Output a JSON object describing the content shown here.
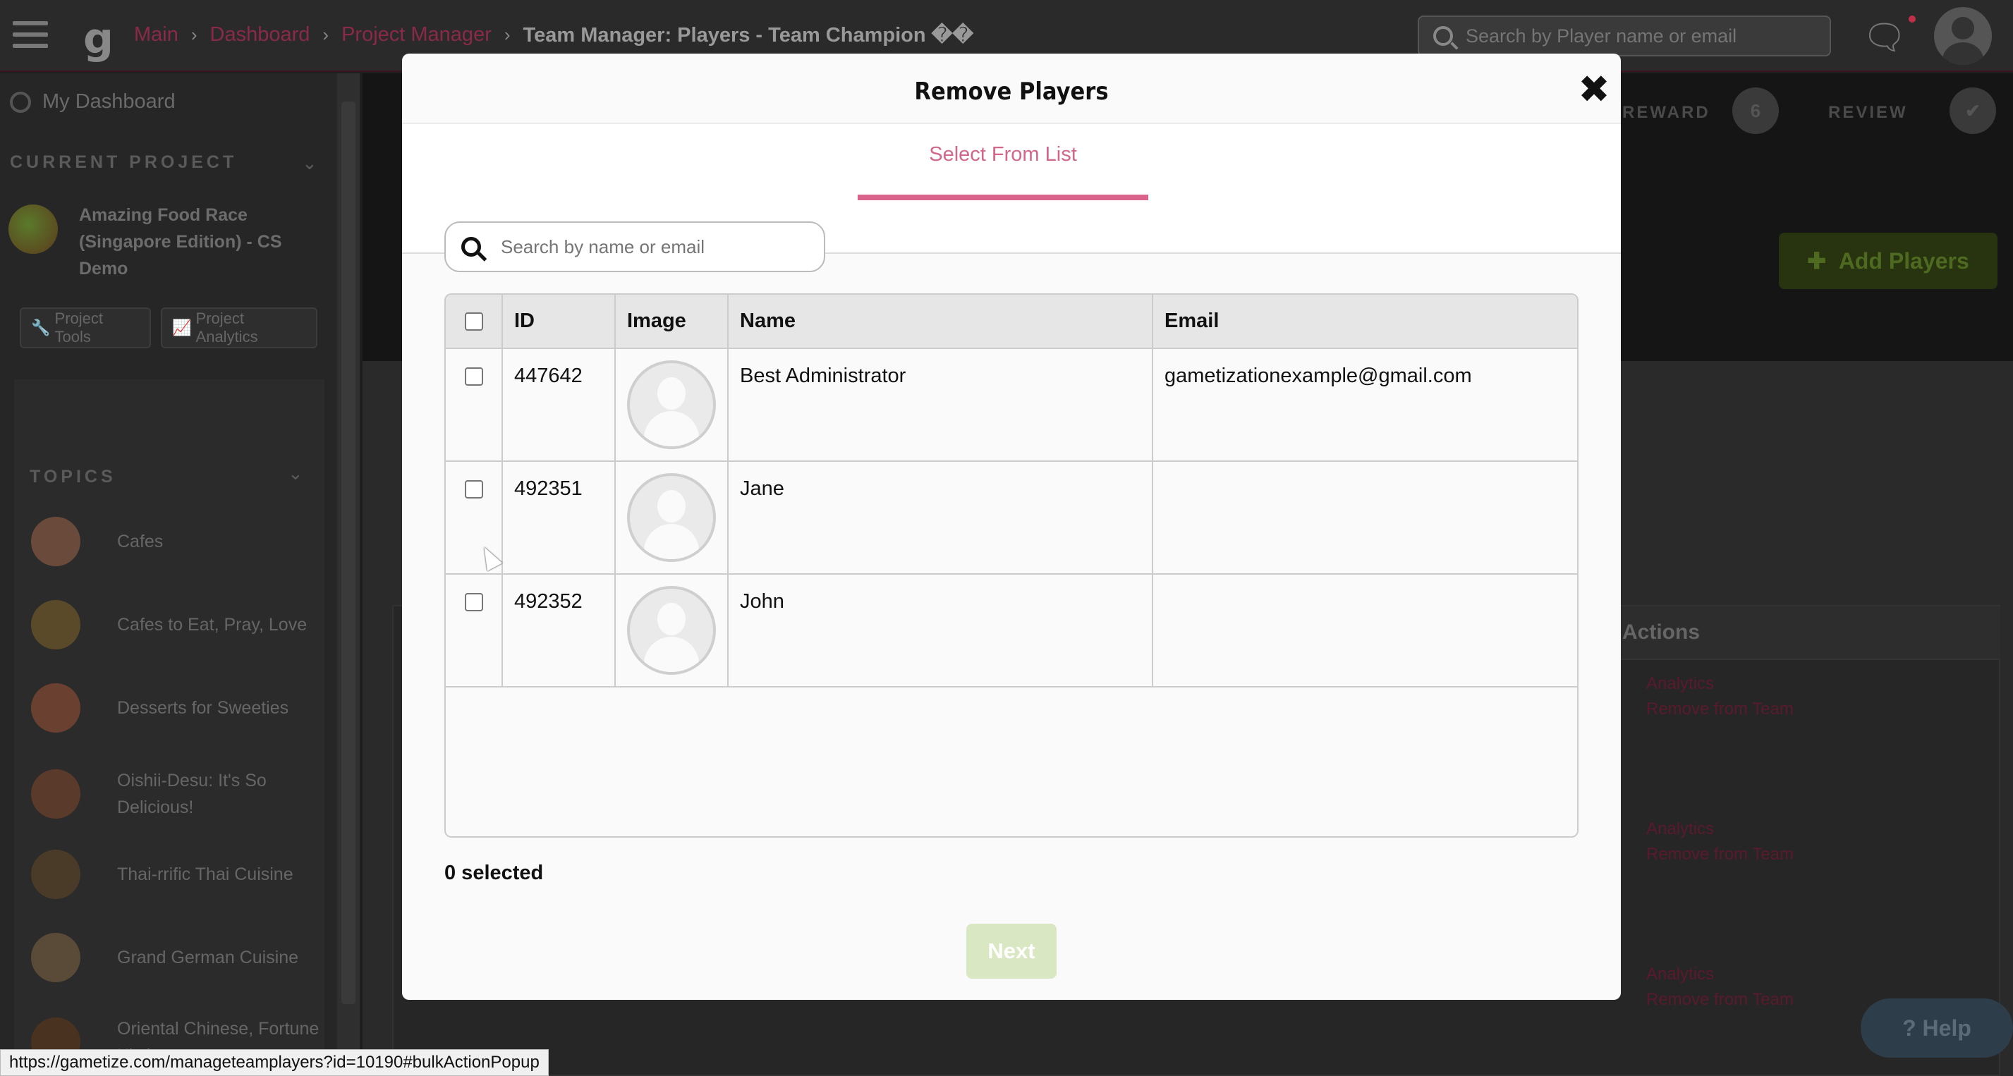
{
  "topbar": {
    "breadcrumbs": [
      "Main",
      "Dashboard",
      "Project Manager"
    ],
    "current_page": "Team Manager: Players - Team Champion ��",
    "search_placeholder": "Search by Player name or email"
  },
  "sidebar": {
    "my_dashboard": "My Dashboard",
    "current_project_label": "CURRENT PROJECT",
    "project_name": "Amazing Food Race (Singapore Edition) - CS Demo",
    "project_tools": "Project Tools",
    "project_analytics": "Project Analytics",
    "topics_label": "TOPICS",
    "topics": [
      {
        "label": "Cafes",
        "color": "#6a4a3a"
      },
      {
        "label": "Cafes to Eat, Pray, Love",
        "color": "#5a4a2a"
      },
      {
        "label": "Desserts for Sweeties",
        "color": "#6a4030"
      },
      {
        "label": "Oishii-Desu: It's So Delicious!",
        "color": "#5a3a2a"
      },
      {
        "label": "Thai-rrific Thai Cuisine",
        "color": "#4a3a28"
      },
      {
        "label": "Grand German Cuisine",
        "color": "#5a4a38"
      },
      {
        "label": "Oriental Chinese, Fortune Kitchen",
        "color": "#4a3220"
      }
    ]
  },
  "background": {
    "wizard_steps": [
      "REWARD",
      "REVIEW"
    ],
    "wizard_number": "6",
    "add_players": "Add Players",
    "actions_header": "Actions",
    "row_actions": [
      {
        "analytics": "Analytics",
        "remove": "Remove from Team"
      },
      {
        "analytics": "Analytics",
        "remove": "Remove from Team"
      },
      {
        "analytics": "Analytics",
        "remove": "Remove from Team"
      }
    ],
    "help": "Help"
  },
  "modal": {
    "title": "Remove Players",
    "close": "✖",
    "tab": "Select From List",
    "search_placeholder": "Search by name or email",
    "columns": [
      "ID",
      "Image",
      "Name",
      "Email"
    ],
    "rows": [
      {
        "id": "447642",
        "name": "Best Administrator",
        "email": "gametizationexample@gmail.com"
      },
      {
        "id": "492351",
        "name": "Jane",
        "email": ""
      },
      {
        "id": "492352",
        "name": "John",
        "email": ""
      }
    ],
    "selected_count": "0 selected",
    "next": "Next"
  },
  "status_bar": "https://gametize.com/manageteamplayers?id=10190#bulkActionPopup",
  "colors": {
    "accent_pink": "#d9638a",
    "next_disabled": "#d9e8c2"
  }
}
